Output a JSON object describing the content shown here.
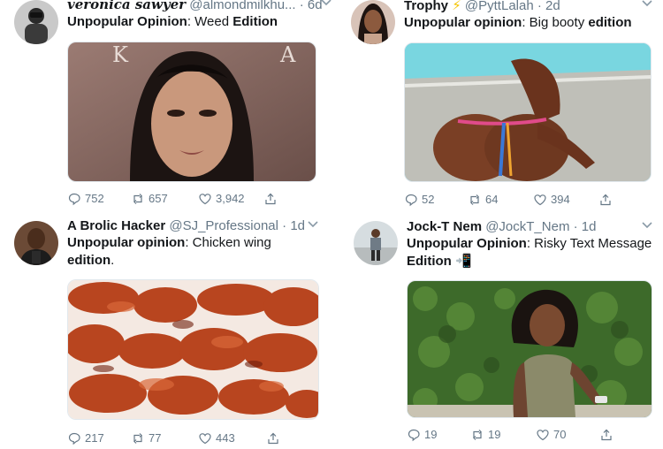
{
  "tweets": [
    {
      "name": "veronica sawyer",
      "handle": "@almondmilkhu...",
      "time": "6d",
      "text_bold": "Unpopular Opinion",
      "text_rest": ": Weed ",
      "text_bold2": "Edition",
      "replies": "752",
      "retweets": "657",
      "likes": "3,942"
    },
    {
      "name": "Trophy",
      "emoji": "⚡",
      "handle": "@PyttLalah",
      "time": "2d",
      "text_bold": "Unpopular opinion",
      "text_rest": ": Big booty ",
      "text_bold2": "edition",
      "replies": "52",
      "retweets": "64",
      "likes": "394"
    },
    {
      "name": "A Brolic Hacker",
      "handle": "@SJ_Professional",
      "time": "1d",
      "text_bold": "Unpopular opinion",
      "text_rest": ": Chicken wing",
      "text_bold2": "edition",
      "text_tail": ".",
      "replies": "217",
      "retweets": "77",
      "likes": "443"
    },
    {
      "name": "Jock-T Nem",
      "handle": "@JockT_Nem",
      "time": "1d",
      "text_bold": "Unpopular Opinion",
      "text_rest": ": Risky Text Message",
      "text_bold2": "Edition",
      "emoji": "📲",
      "replies": "19",
      "retweets": "19",
      "likes": "70"
    }
  ],
  "sep": "·",
  "photo_text": "K A"
}
